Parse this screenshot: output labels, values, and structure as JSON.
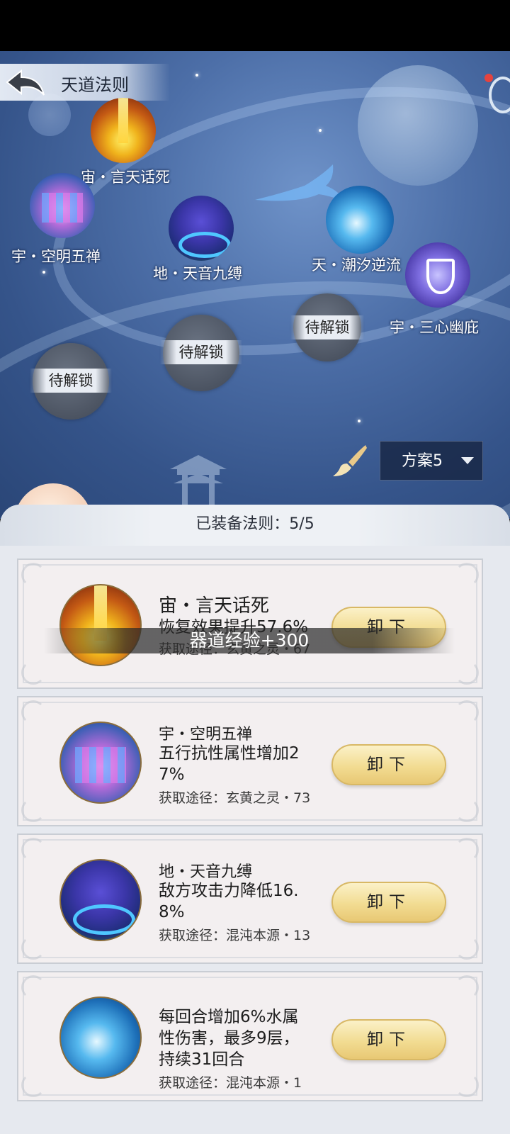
{
  "header": {
    "title": "天道法则"
  },
  "nodes": [
    {
      "label": "宙・言天话死",
      "icon": "golden-pillar-icon"
    },
    {
      "label": "宇・空明五禅",
      "icon": "prism-icon"
    },
    {
      "label": "地・天音九缚",
      "icon": "spirit-vortex-icon"
    },
    {
      "label": "天・潮汐逆流",
      "icon": "water-wave-icon"
    },
    {
      "label": "宇・三心幽庇",
      "icon": "shield-icon"
    }
  ],
  "locked_nodes": [
    "待解锁",
    "待解锁",
    "待解锁"
  ],
  "plan": {
    "label": "方案5"
  },
  "panel": {
    "equipped_text": "已装备法则：5/5"
  },
  "cards": [
    {
      "name": "宙・言天话死",
      "effect": "恢复效果提升57.6%",
      "source": "获取途径：玄黄之灵・67",
      "button": "卸下",
      "icon": "golden-pillar-icon"
    },
    {
      "name": "宇・空明五禅",
      "effect": "五行抗性属性增加27%",
      "source": "获取途径：玄黄之灵・73",
      "button": "卸下",
      "icon": "prism-icon"
    },
    {
      "name": "地・天音九缚",
      "effect": "敌方攻击力降低16.8%",
      "source": "获取途径：混沌本源・13",
      "button": "卸下",
      "icon": "spirit-vortex-icon"
    },
    {
      "name": "",
      "effect": "每回合增加6%水属性伤害，最多9层，持续31回合",
      "source": "获取途径：混沌本源・1",
      "button": "卸下",
      "icon": "water-wave-icon"
    }
  ],
  "toast": "器道经验+300",
  "colors": {
    "accent_gold": "#f2dc92",
    "notification": "#e5433e",
    "sky": "#4d6fa8"
  }
}
